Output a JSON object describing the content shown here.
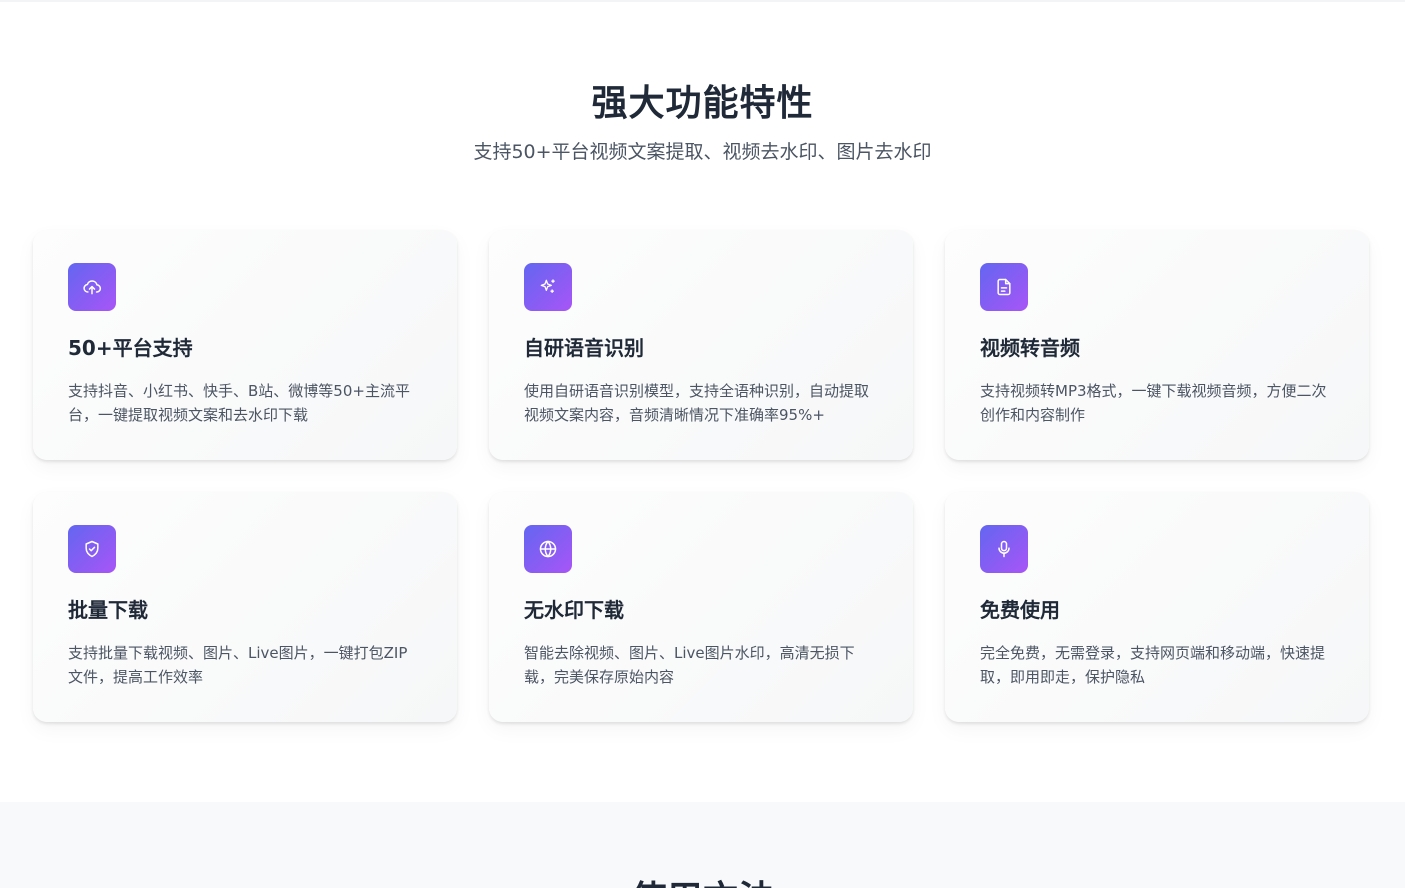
{
  "header": {
    "title": "强大功能特性",
    "subtitle": "支持50+平台视频文案提取、视频去水印、图片去水印"
  },
  "features": [
    {
      "icon": "cloud-upload-icon",
      "title": "50+平台支持",
      "desc": "支持抖音、小红书、快手、B站、微博等50+主流平台，一键提取视频文案和去水印下载"
    },
    {
      "icon": "sparkles-icon",
      "title": "自研语音识别",
      "desc": "使用自研语音识别模型，支持全语种识别，自动提取视频文案内容，音频清晰情况下准确率95%+"
    },
    {
      "icon": "document-icon",
      "title": "视频转音频",
      "desc": "支持视频转MP3格式，一键下载视频音频，方便二次创作和内容制作"
    },
    {
      "icon": "shield-check-icon",
      "title": "批量下载",
      "desc": "支持批量下载视频、图片、Live图片，一键打包ZIP文件，提高工作效率"
    },
    {
      "icon": "globe-icon",
      "title": "无水印下载",
      "desc": "智能去除视频、图片、Live图片水印，高清无损下载，完美保存原始内容"
    },
    {
      "icon": "microphone-icon",
      "title": "免费使用",
      "desc": "完全免费，无需登录，支持网页端和移动端，快速提取，即用即走，保护隐私"
    }
  ],
  "next_section": {
    "title": "使用方法"
  },
  "colors": {
    "accent_start": "#6366f1",
    "accent_end": "#a855f7",
    "heading": "#1f2937",
    "body_text": "#4b5563"
  }
}
